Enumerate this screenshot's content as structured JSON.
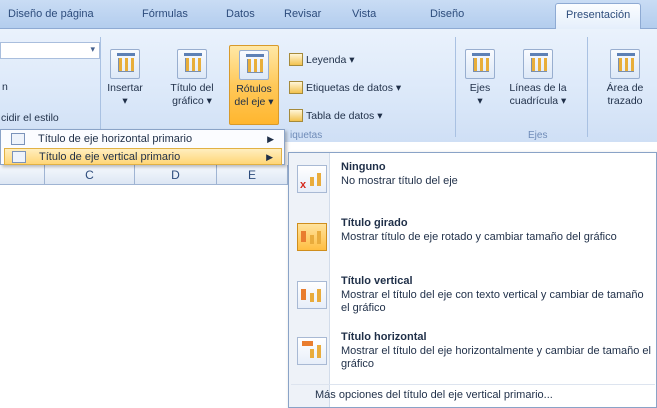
{
  "tabs": [
    "Diseño de página",
    "Fórmulas",
    "Datos",
    "Revisar",
    "Vista",
    "Diseño",
    "Presentación"
  ],
  "ribbon": {
    "style_left_text": "n",
    "style_button": "cidir el estilo",
    "insertar": "Insertar",
    "titulo_grafico": [
      "Título del",
      "gráfico"
    ],
    "rotulos_eje": [
      "Rótulos",
      "del eje"
    ],
    "leyenda": "Leyenda",
    "etiquetas_datos": "Etiquetas de datos",
    "tabla_datos": "Tabla de datos",
    "ejes": "Ejes",
    "lineas_cuadricula": [
      "Líneas de la",
      "cuadrícula"
    ],
    "area_trazado": [
      "Área de",
      "trazado"
    ],
    "group_labels": {
      "etiquetas": "iquetas",
      "ejes": "Ejes"
    }
  },
  "sheet": {
    "columns": [
      "C",
      "D",
      "E"
    ]
  },
  "submenu": {
    "items": [
      "Título de eje horizontal primario",
      "Título de eje vertical primario"
    ],
    "selected_index": 1
  },
  "dropdown": {
    "options": [
      {
        "title": "Ninguno",
        "desc": "No mostrar título del eje",
        "icon": "no-axis-title-icon"
      },
      {
        "title": "Título girado",
        "desc": "Mostrar título de eje rotado y cambiar tamaño del gráfico",
        "icon": "rotated-title-icon"
      },
      {
        "title": "Título vertical",
        "desc": "Mostrar el título del eje con texto vertical y cambiar de tamaño el gráfico",
        "icon": "vertical-title-icon"
      },
      {
        "title": "Título horizontal",
        "desc": "Mostrar el título del eje horizontalmente y cambiar de tamaño el gráfico",
        "icon": "horizontal-title-icon"
      }
    ],
    "selected_index": 1,
    "more": "Más opciones del título del eje vertical primario..."
  },
  "colors": {
    "highlight": "#ffc95a",
    "ribbon": "#dbe8f9",
    "accent_text": "#2d4c7c"
  }
}
